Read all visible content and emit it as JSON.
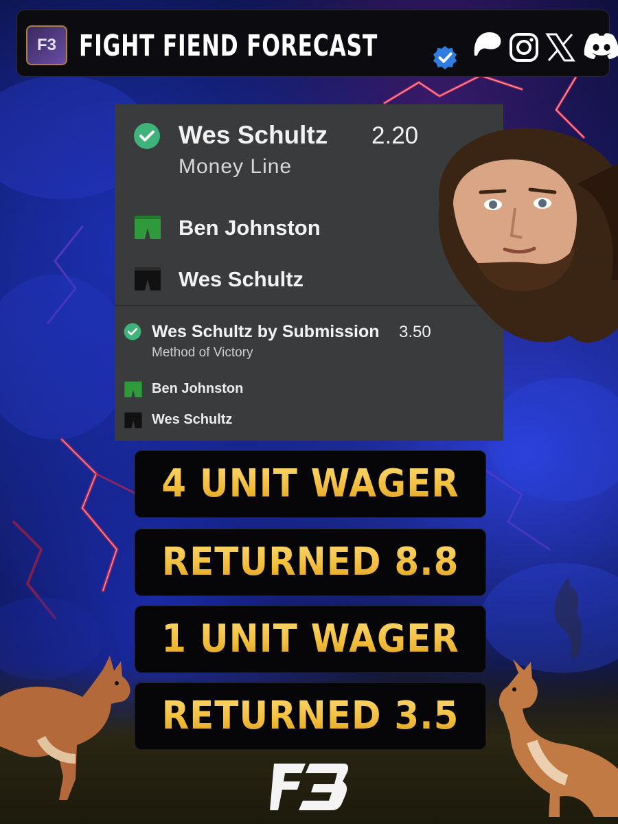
{
  "header": {
    "logo_text": "F3",
    "brand": "FIGHT FIEND FORECAST",
    "icons": [
      "verified-badge-icon",
      "patreon-icon",
      "instagram-icon",
      "x-icon",
      "discord-icon"
    ]
  },
  "bet_card": {
    "pick1": {
      "selection": "Wes Schultz",
      "odds": "2.20",
      "market": "Money Line"
    },
    "pick2": {
      "selection": "Wes Schultz by Submission",
      "odds": "3.50",
      "market": "Method of Victory"
    },
    "fighters": [
      {
        "name": "Ben Johnston",
        "shorts_color": "#2f9a3c"
      },
      {
        "name": "Wes Schultz",
        "shorts_color": "#111111"
      }
    ],
    "check_color": "#3fb37a"
  },
  "results": {
    "line1": "4 UNIT WAGER",
    "line2": "RETURNED 8.8",
    "line3": "1 UNIT WAGER",
    "line4": "RETURNED 3.5"
  },
  "footer": {
    "logo_text": "F3"
  },
  "colors": {
    "accent_gold": "#f4c54a",
    "background_blue": "#1b2fb0",
    "lightning_red": "#e0304a",
    "card_bg": "#3a3b3d"
  }
}
